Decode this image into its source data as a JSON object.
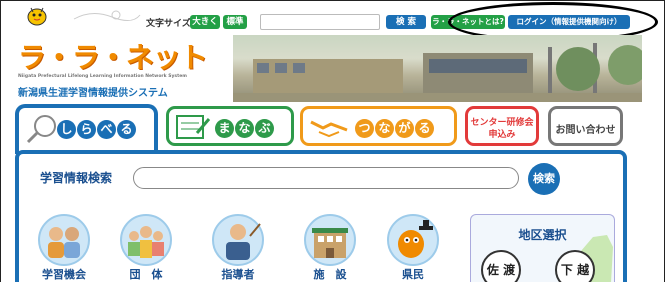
{
  "header": {
    "font_size_label": "文字サイズ",
    "font_large": "大きく",
    "font_standard": "標準",
    "search_placeholder": "",
    "search_button": "検 索",
    "about_button": "ラ・ラ・ネットとは?",
    "login_button": "ログイン（情報提供機関向け）"
  },
  "logo": {
    "title": "ラ・ラ・ネット",
    "subtitle_en": "Niigata Prefectural Lifelong Learning Information Network System",
    "subtitle_ja": "新潟県生涯学習情報提供システム"
  },
  "tabs": [
    {
      "label": "しらべる",
      "color": "#1a6fb5"
    },
    {
      "label": "まなぶ",
      "color": "#2e9a4a"
    },
    {
      "label": "つながる",
      "color": "#f09a1a"
    },
    {
      "label": "センター研修会申込み",
      "line1": "センター研修会",
      "line2": "申込み",
      "color": "#e23a3a"
    },
    {
      "label": "お問い合わせ",
      "color": "#555555"
    }
  ],
  "search": {
    "title": "学習情報検索",
    "button": "検索",
    "placeholder": ""
  },
  "categories": [
    "学習機会",
    "団　体",
    "指導者",
    "施　設",
    "県民"
  ],
  "region": {
    "title": "地区選択",
    "buttons": [
      "佐 渡",
      "下 越"
    ]
  },
  "colors": {
    "accent_blue": "#1a6fb5",
    "green": "#2e9a4a",
    "orange": "#f09a1a",
    "red": "#e23a3a"
  }
}
